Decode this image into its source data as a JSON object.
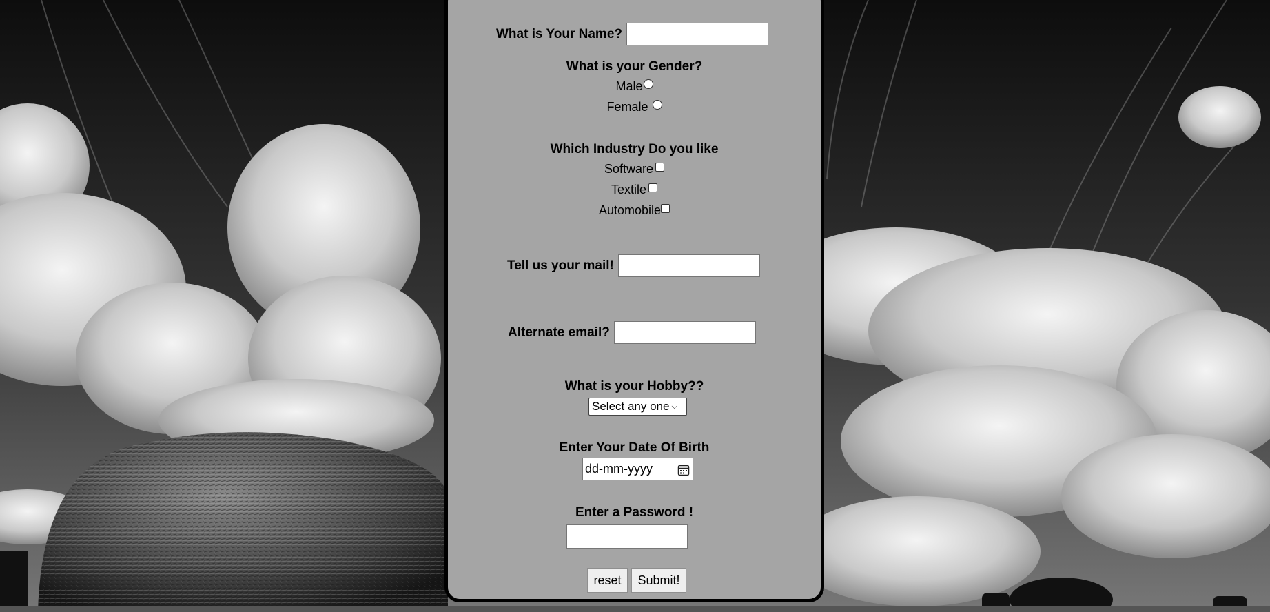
{
  "form": {
    "name_label": "What is Your Name?",
    "gender_label": "What is your Gender?",
    "gender_options": [
      "Male",
      "Female"
    ],
    "industry_label": "Which Industry Do you like",
    "industry_options": [
      "Software",
      "Textile",
      "Automobile"
    ],
    "mail_label": "Tell us your mail!",
    "alt_email_label": "Alternate email?",
    "hobby_label": "What is your Hobby??",
    "hobby_select": "Select any one",
    "dob_label": "Enter Your Date Of Birth",
    "dob_placeholder": "dd-mm-yyyy",
    "password_label": "Enter a Password !",
    "reset_label": "reset",
    "submit_label": "Submit!"
  },
  "icons": {
    "calendar": "calendar-icon",
    "dropdown": "chevron-down-icon"
  },
  "colors": {
    "panel_background": "#a5a5a5",
    "panel_border": "#000000"
  }
}
